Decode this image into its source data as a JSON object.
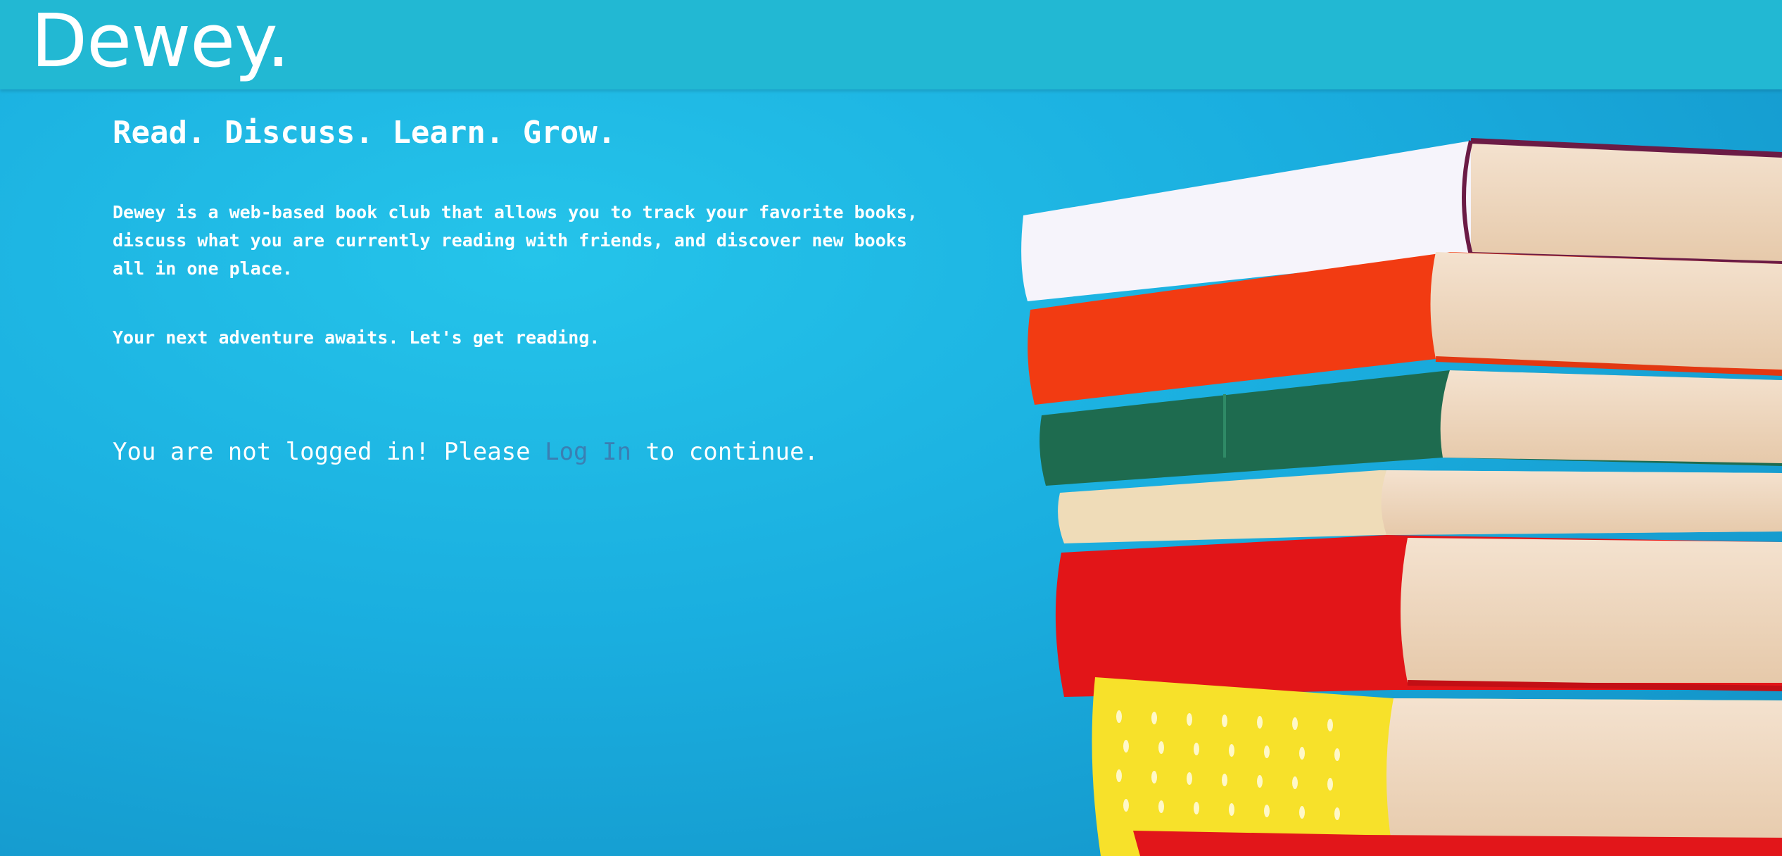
{
  "header": {
    "brand": "Dewey."
  },
  "main": {
    "tagline": "Read. Discuss. Learn. Grow.",
    "description": "Dewey is a web-based book club that allows you to track your favorite books, discuss what you are currently reading with friends, and discover new books all in one place.",
    "adventure": "Your next adventure awaits. Let's get reading.",
    "login_prefix": "You are not logged in! Please ",
    "login_link": "Log In",
    "login_suffix": " to continue."
  },
  "hero": {
    "image_name": "stacked-books-image"
  },
  "colors": {
    "header_bg": "#22b8d3",
    "page_bg": "#1aaedf",
    "link": "#3a7fb3",
    "text": "#ffffff"
  }
}
